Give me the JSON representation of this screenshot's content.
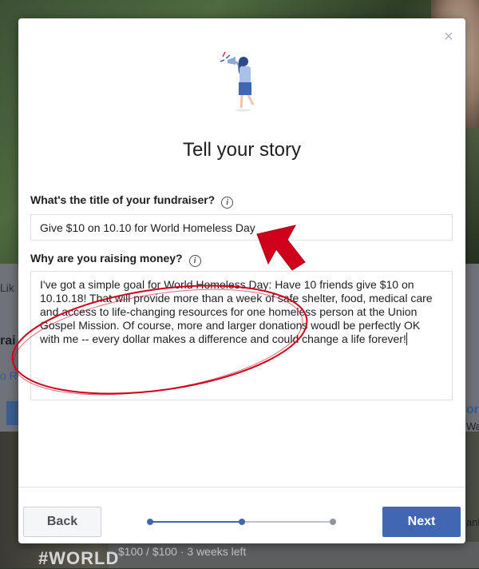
{
  "background": {
    "strip_label_1": "Lik",
    "strip_label_2": "rai",
    "strip_label_3": "o Re",
    "strip_label_4": "on",
    "strip_label_5": "Wal",
    "strip_label_6": "anl",
    "bottom_banner": "#WORLD",
    "bottom_progress": "$100 / $100 · 3 weeks left"
  },
  "modal": {
    "close_icon": "close-icon",
    "illustration": "woman-with-megaphone-icon",
    "title": "Tell your story",
    "fundraiser_title": {
      "label": "What's the title of your fundraiser?",
      "value": "Give $10 on 10.10 for World Homeless Day"
    },
    "reason": {
      "label": "Why are you raising money?",
      "value": "I've got a simple goal for World Homeless Day: Have 10 friends give $10 on 10.10.18! That will provide more than a week of safe shelter, food, medical care and access to life-changing resources for one homeless person at the Union Gospel Mission. Of course, more and larger donations woudl be perfectly OK with me -- every dollar makes a difference and could change a life forever!"
    },
    "info_glyph": "i",
    "back_label": "Back",
    "next_label": "Next",
    "steps": {
      "total": 3,
      "current": 2
    }
  },
  "colors": {
    "primary": "#4267b2",
    "annotation_red": "#d0021b",
    "step_inactive": "#bec3c9"
  }
}
